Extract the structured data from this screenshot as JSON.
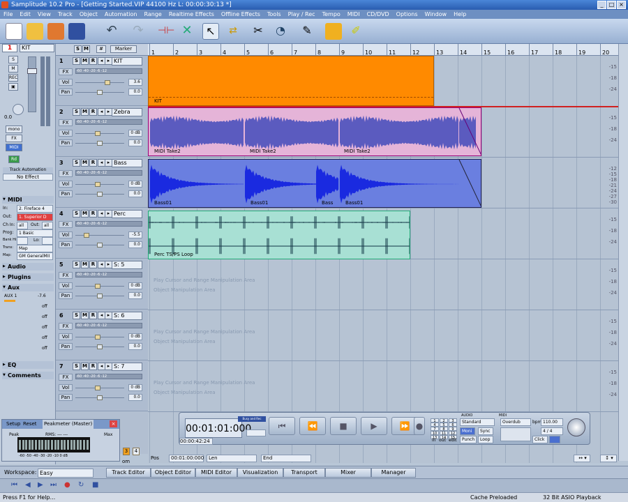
{
  "window": {
    "title": "Samplitude 10.2 Pro - [Getting Started.VIP   44100 Hz L: 00:00:30:13 *]"
  },
  "menu": [
    "File",
    "Edit",
    "View",
    "Track",
    "Object",
    "Automation",
    "Range",
    "Realtime Effects",
    "Offline Effects",
    "Tools",
    "Play / Rec",
    "Tempo",
    "MIDI",
    "CD/DVD",
    "Options",
    "Window",
    "Help"
  ],
  "ruler": {
    "marks": [
      "1",
      "2",
      "3",
      "4",
      "5",
      "6",
      "7",
      "8",
      "9",
      "10",
      "11",
      "12",
      "13",
      "14",
      "15",
      "16",
      "17",
      "18",
      "19",
      "20"
    ]
  },
  "toprow": {
    "track_no": "1",
    "track_name": "KIT",
    "marker": "Marker"
  },
  "left_panel": {
    "vol_value": "0.0",
    "buttons": {
      "s": "S",
      "m": "M",
      "rec": "REC",
      "mono": "mono",
      "fx": "FX",
      "midi": "MIDI",
      "rd": "Rd"
    },
    "automation": "Track Automation",
    "no_effect": "No Effect",
    "midi_section": "MIDI",
    "midi_in_label": "In:",
    "midi_in": "2. Fireface 4",
    "midi_out_label": "Out:",
    "midi_out": "1. Superior D",
    "midi_ch_label": "Ch In:",
    "midi_ch_in": "all",
    "midi_ch_out_label": "Out:",
    "midi_ch_out": "all",
    "midi_prog_label": "Prog:",
    "midi_prog": "1 Basic",
    "midi_bank_label": "Bank Hi:",
    "midi_bank_lo_label": "Lo:",
    "midi_trans_label": "Trans:",
    "midi_trans": "Map",
    "midi_map_label": "Map:",
    "midi_map": "GM GeneralMII",
    "audio": "Audio",
    "plugins": "Plugins",
    "aux": "Aux",
    "aux1_name": "AUX   1",
    "aux1_val": "-7.6",
    "aux_off": "off",
    "eq": "EQ",
    "comments": "Comments"
  },
  "track_labels": {
    "s": "S",
    "m": "M",
    "r": "R",
    "fx": "FX",
    "vol": "Vol",
    "pan": "Pan",
    "meter": "-60 -40 -20 -6 -12"
  },
  "tracks": [
    {
      "num": "1",
      "name": "KIT",
      "vol": "3.6",
      "pan": "0.0"
    },
    {
      "num": "2",
      "name": "Zebra",
      "vol": "0 dB",
      "pan": "0.0"
    },
    {
      "num": "3",
      "name": "Bass",
      "vol": "0 dB",
      "pan": "0.0"
    },
    {
      "num": "4",
      "name": "Perc",
      "vol": "-5.5",
      "pan": "0.0"
    },
    {
      "num": "5",
      "name": "S: 5",
      "vol": "0 dB",
      "pan": "0.0"
    },
    {
      "num": "6",
      "name": "S: 6",
      "vol": "0 dB",
      "pan": "0.0"
    },
    {
      "num": "7",
      "name": "S: 7",
      "vol": "0 dB",
      "pan": "0.0"
    }
  ],
  "clips": {
    "kit": "KIT",
    "zebra": [
      "MIDI Take2",
      "MIDI Take2",
      "MIDI Take2"
    ],
    "bass": [
      "Bass01",
      "Bass01",
      "Bass",
      "Bass01"
    ],
    "perc": "Perc   TS/PS   Loop"
  },
  "hints": {
    "line1": "Play Cursor and Range Manipulation Area",
    "line2": "Object Manipulation Area"
  },
  "scale_ticks": [
    "-15",
    "-18",
    "-24"
  ],
  "bass_scale": [
    "-12",
    "-15",
    "-18",
    "-21",
    "-24",
    "-27",
    "-30"
  ],
  "transport": {
    "timecode": "00:01:01:000",
    "sub": "00:00:42:24",
    "mode": "Standard",
    "overdub": "Overdub",
    "bpm_label": "bpm",
    "bpm": "110.00",
    "sig": "4 / 4",
    "keypad": [
      "1",
      "2",
      "3",
      "4",
      "5",
      "6",
      "7",
      "8",
      "9",
      "10",
      "11",
      "12",
      "13",
      "14",
      "15"
    ],
    "moni": "Moni",
    "sync": "Sync",
    "punch": "Punch",
    "loop": "Loop",
    "click": "Click",
    "in": "in",
    "out": "out",
    "edit": "edit",
    "audio": "AUDIO",
    "midi": "MIDI",
    "mode_small": "Busy and Rec"
  },
  "peakmeter": {
    "tabs": [
      "Setup",
      "Reset",
      "Peakmeter (Master)"
    ],
    "peak": "Peak",
    "rms": "RMS: ---   ---",
    "max": "Max",
    "scale": "-60 -50 -40 -30 -20 -10 0 dB",
    "cursor": "om"
  },
  "position": {
    "pos_label": "Pos",
    "pos": "00:01:00:000",
    "len_label": "Len",
    "end_label": "End"
  },
  "bottom_tabs": {
    "workspace_label": "Workspace:",
    "workspace": "Easy",
    "tabs": [
      "Track Editor",
      "Object Editor",
      "MIDI Editor",
      "Visualization",
      "Transport",
      "Mixer",
      "Manager"
    ]
  },
  "status": {
    "help": "Press F1 for Help...",
    "cache": "Cache Preloaded",
    "engine": "32 Bit ASIO Playback"
  },
  "colors": {
    "kit": "#ff8a00",
    "zebra": "#e5b4d8",
    "bass": "#6a7fe0",
    "perc": "#a8e0d4"
  }
}
